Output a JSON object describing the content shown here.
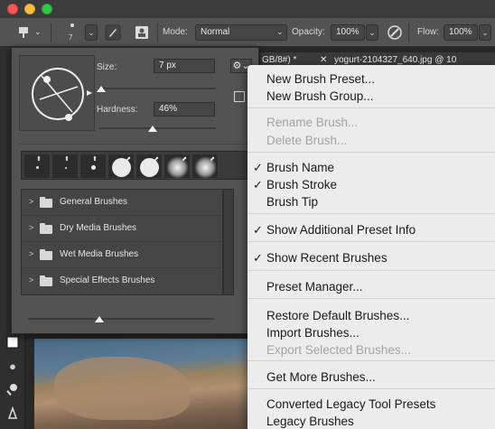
{
  "options_bar": {
    "brush_size_value": "7",
    "mode_label": "Mode:",
    "mode_value": "Normal",
    "opacity_label": "Opacity:",
    "opacity_value": "100%",
    "flow_label": "Flow:",
    "flow_value": "100%"
  },
  "tabs": {
    "doc1": "GB/8#) *",
    "doc2": "yogurt-2104327_640.jpg @ 10"
  },
  "brush_panel": {
    "size_label": "Size:",
    "size_value": "7 px",
    "size_fraction": 0.02,
    "hardness_label": "Hardness:",
    "hardness_value": "46%",
    "hardness_fraction": 0.46,
    "folders": [
      {
        "label": "General Brushes"
      },
      {
        "label": "Dry Media Brushes"
      },
      {
        "label": "Wet Media Brushes"
      },
      {
        "label": "Special Effects Brushes"
      }
    ]
  },
  "menu": {
    "items": [
      {
        "label": "New Brush Preset...",
        "enabled": true,
        "checked": false
      },
      {
        "label": "New Brush Group...",
        "enabled": true,
        "checked": false
      },
      {
        "label": "Rename Brush...",
        "enabled": false,
        "checked": false
      },
      {
        "label": "Delete Brush...",
        "enabled": false,
        "checked": false
      },
      {
        "label": "Brush Name",
        "enabled": true,
        "checked": true
      },
      {
        "label": "Brush Stroke",
        "enabled": true,
        "checked": true
      },
      {
        "label": "Brush Tip",
        "enabled": true,
        "checked": false
      },
      {
        "label": "Show Additional Preset Info",
        "enabled": true,
        "checked": true
      },
      {
        "label": "Show Recent Brushes",
        "enabled": true,
        "checked": true
      },
      {
        "label": "Preset Manager...",
        "enabled": true,
        "checked": false
      },
      {
        "label": "Restore Default Brushes...",
        "enabled": true,
        "checked": false
      },
      {
        "label": "Import Brushes...",
        "enabled": true,
        "checked": false
      },
      {
        "label": "Export Selected Brushes...",
        "enabled": false,
        "checked": false
      },
      {
        "label": "Get More Brushes...",
        "enabled": true,
        "checked": false
      },
      {
        "label": "Converted Legacy Tool Presets",
        "enabled": true,
        "checked": false
      },
      {
        "label": "Legacy Brushes",
        "enabled": true,
        "checked": false
      }
    ],
    "check_glyph": "✓"
  },
  "icons": {
    "tool": "brush-tool-icon",
    "gear": "gear-icon",
    "airbrush": "airbrush-icon"
  }
}
